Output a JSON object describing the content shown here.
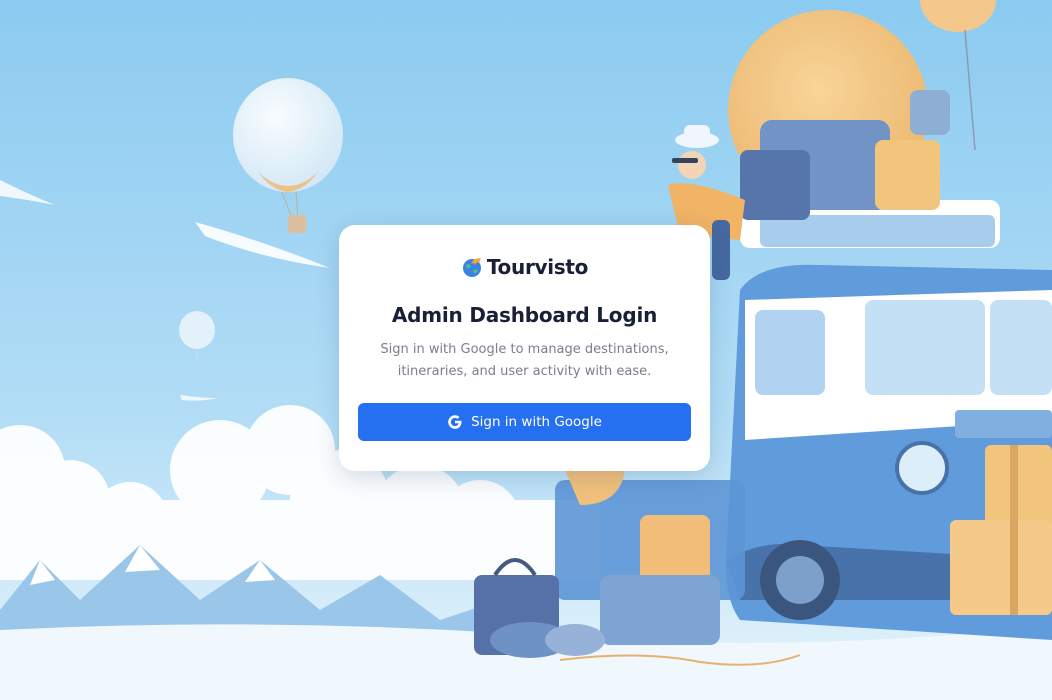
{
  "brand": {
    "name": "Tourvisto",
    "logo_icon": "globe-plane-icon"
  },
  "login": {
    "title": "Admin Dashboard Login",
    "subtitle": "Sign in with Google to manage destinations, itineraries, and user activity with ease.",
    "google_button_label": "Sign in with Google",
    "google_icon": "google-g-icon"
  },
  "colors": {
    "accent": "#256ff1",
    "sky": "#8fcaf0",
    "title_text": "#1a1f36",
    "muted_text": "#7a7f8c"
  }
}
